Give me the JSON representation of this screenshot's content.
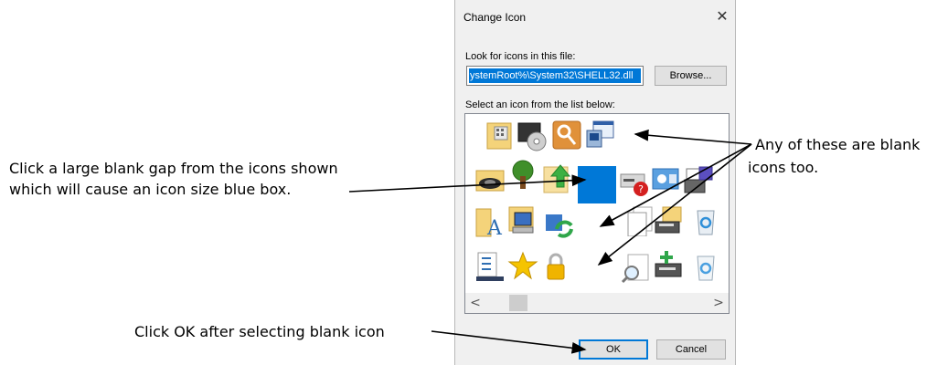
{
  "annotations": {
    "left_line1": "Click a large blank gap from the icons shown",
    "left_line2": "which will cause an icon size blue box.",
    "right_line1": "Any of these are blank",
    "right_line2": "icons too.",
    "bottom": "Click OK after selecting blank icon"
  },
  "dialog": {
    "title": "Change Icon",
    "close_glyph": "✕",
    "file_label": "Look for icons in this file:",
    "file_value": "ystemRoot%\\System32\\SHELL32.dll",
    "browse_label": "Browse...",
    "list_label": "Select an icon from the list below:",
    "scroll_left": "<",
    "scroll_right": ">",
    "ok_label": "OK",
    "cancel_label": "Cancel"
  },
  "colors": {
    "selection_blue": "#0078d7",
    "arrow": "#000000"
  }
}
